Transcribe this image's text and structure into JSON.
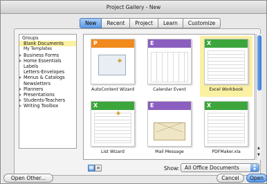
{
  "window": {
    "title": "Project Gallery - New"
  },
  "tabs": [
    {
      "label": "New",
      "active": true
    },
    {
      "label": "Recent",
      "active": false
    },
    {
      "label": "Project",
      "active": false
    },
    {
      "label": "Learn",
      "active": false
    },
    {
      "label": "Customize",
      "active": false
    }
  ],
  "sidebar": {
    "heading": "Groups",
    "items": [
      {
        "label": "Blank Documents",
        "selected": true,
        "expandable": false
      },
      {
        "label": "My Templates",
        "selected": false,
        "expandable": false
      },
      {
        "label": "Business Forms",
        "selected": false,
        "expandable": true
      },
      {
        "label": "Home Essentials",
        "selected": false,
        "expandable": true
      },
      {
        "label": "Labels",
        "selected": false,
        "expandable": false
      },
      {
        "label": "Letters-Envelopes",
        "selected": false,
        "expandable": false
      },
      {
        "label": "Menus & Catalogs",
        "selected": false,
        "expandable": true
      },
      {
        "label": "Newsletters",
        "selected": false,
        "expandable": false
      },
      {
        "label": "Planners",
        "selected": false,
        "expandable": true
      },
      {
        "label": "Presentations",
        "selected": false,
        "expandable": true
      },
      {
        "label": "Students-Teachers",
        "selected": false,
        "expandable": true
      },
      {
        "label": "Writing Toolbox",
        "selected": false,
        "expandable": true
      }
    ]
  },
  "gallery": {
    "items": [
      {
        "label": "AutoContent Wizard",
        "icon": "powerpoint-wizard-icon",
        "color": "#f08a1c"
      },
      {
        "label": "Calendar Event",
        "icon": "entourage-calendar-icon",
        "color": "#8b5fbf"
      },
      {
        "label": "Excel Workbook",
        "icon": "excel-workbook-icon",
        "color": "#3ca63c",
        "selected": true
      },
      {
        "label": "List Wizard",
        "icon": "excel-list-wizard-icon",
        "color": "#3ca63c"
      },
      {
        "label": "Mail Message",
        "icon": "entourage-mail-icon",
        "color": "#8b5fbf"
      },
      {
        "label": "PDFMaker.xla",
        "icon": "excel-addin-icon",
        "color": "#3ca63c"
      }
    ]
  },
  "footer": {
    "show_label": "Show:",
    "show_value": "All Office Documents",
    "open_other": "Open Other...",
    "cancel": "Cancel",
    "open": "Open"
  },
  "colors": {
    "accent": "#5c9ae6",
    "selection": "#fbf1a3"
  }
}
